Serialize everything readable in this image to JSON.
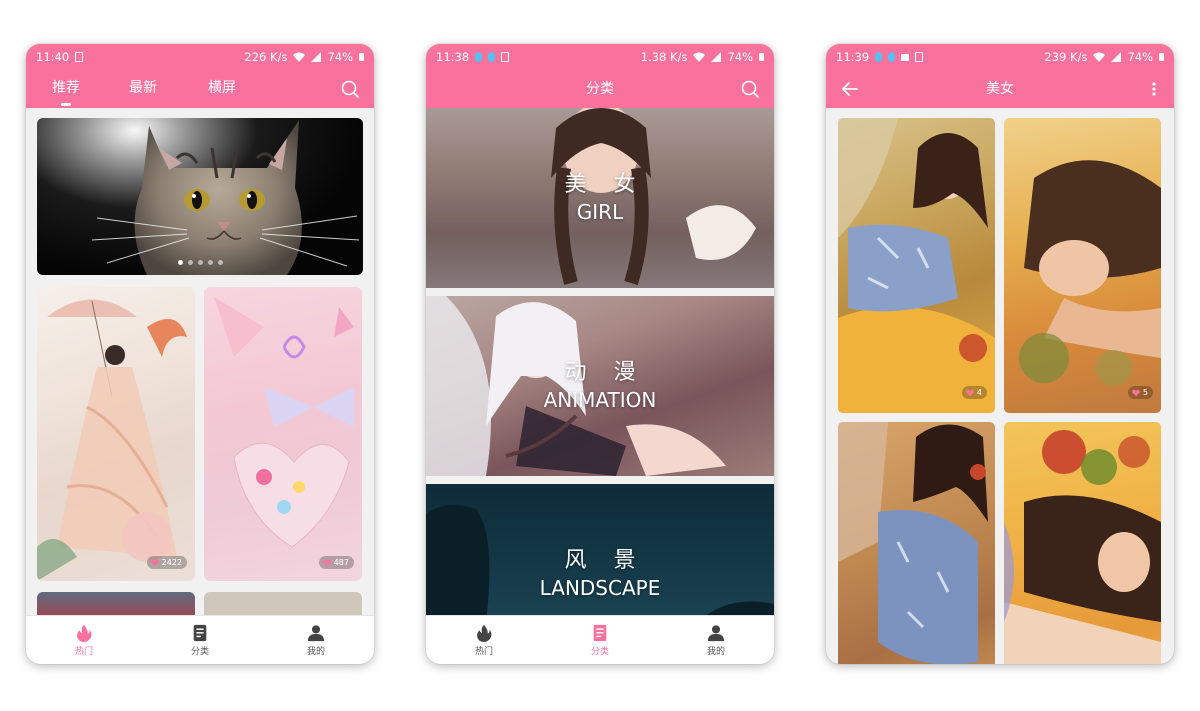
{
  "colors": {
    "accent": "#f9729e",
    "background": "#f1f1f1"
  },
  "screen1": {
    "status": {
      "time": "11:40",
      "speed": "226 K/s",
      "battery": "74%"
    },
    "tabs": [
      {
        "label": "推荐",
        "active": true
      },
      {
        "label": "最新",
        "active": false
      },
      {
        "label": "横屏",
        "active": false
      }
    ],
    "banner": {
      "subject": "cat",
      "dots": 5,
      "active_dot": 0
    },
    "cards": [
      {
        "likes": "2422"
      },
      {
        "likes": "487"
      }
    ],
    "nav": [
      {
        "label": "热门",
        "icon": "fire-icon",
        "active": true
      },
      {
        "label": "分类",
        "icon": "category-icon",
        "active": false
      },
      {
        "label": "我的",
        "icon": "person-icon",
        "active": false
      }
    ]
  },
  "screen2": {
    "status": {
      "time": "11:38",
      "speed": "1.38 K/s",
      "battery": "74%"
    },
    "title": "分类",
    "categories": [
      {
        "zh": "美 女",
        "en": "GIRL"
      },
      {
        "zh": "动 漫",
        "en": "ANIMATION"
      },
      {
        "zh": "风 景",
        "en": "LANDSCAPE"
      }
    ],
    "nav": [
      {
        "label": "热门",
        "icon": "fire-icon",
        "active": false
      },
      {
        "label": "分类",
        "icon": "category-icon",
        "active": true
      },
      {
        "label": "我的",
        "icon": "person-icon",
        "active": false
      }
    ]
  },
  "screen3": {
    "status": {
      "time": "11:39",
      "speed": "239 K/s",
      "battery": "74%"
    },
    "title": "美女",
    "photos": [
      {
        "likes": "4"
      },
      {
        "likes": "5"
      },
      {
        "likes": ""
      },
      {
        "likes": ""
      }
    ]
  }
}
